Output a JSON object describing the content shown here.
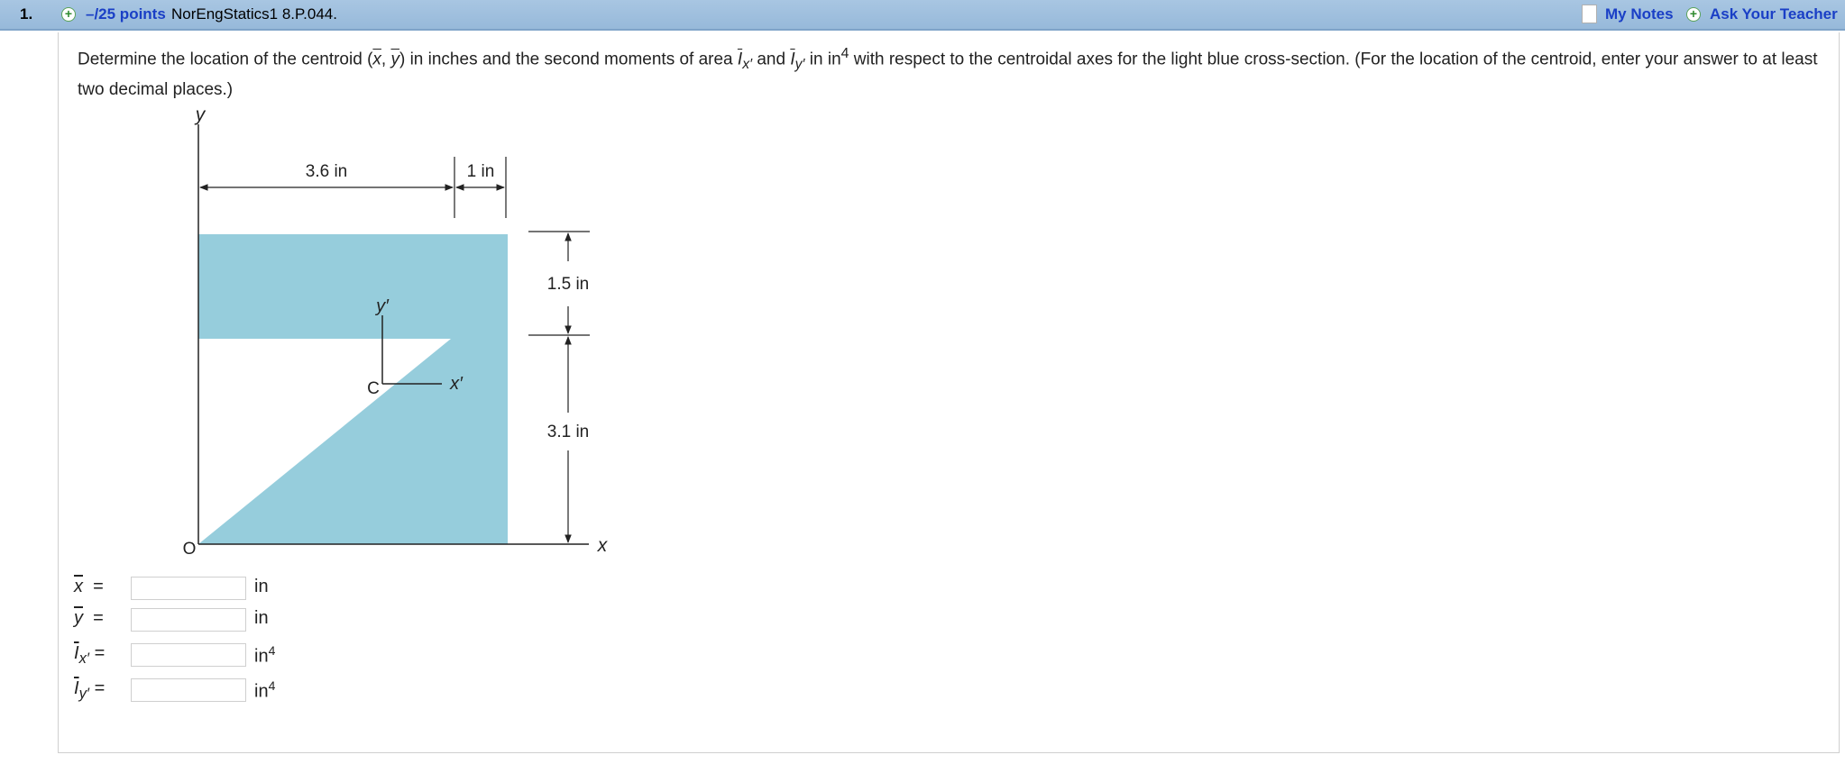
{
  "header": {
    "number": "1.",
    "points": "–/25 points",
    "question_id": "NorEngStatics1 8.P.044.",
    "my_notes": "My Notes",
    "ask_teacher": "Ask Your Teacher"
  },
  "question": {
    "p1": "Determine the location of the centroid (",
    "xbar": "x",
    "comma": ", ",
    "ybar": "y",
    "p2": ") in inches and the second moments of area ",
    "I1": "I",
    "I1_sub": "x′",
    "p3": " and ",
    "I2": "I",
    "I2_sub": "y′",
    "p4": " in in",
    "p4_sup": "4",
    "p5": " with respect to the centroidal axes for the light blue cross-section. (For the location of the centroid, enter your answer to at least two decimal places.)"
  },
  "figure": {
    "label_y": "y",
    "label_x": "x",
    "label_origin": "O",
    "label_c": "C",
    "label_xprime": "x′",
    "label_yprime": "y′",
    "dim_width": "3.6 in",
    "dim_flange": "1 in",
    "dim_top": "1.5 in",
    "dim_bottom": "3.1 in",
    "fill_color": "#96cddc"
  },
  "answers": [
    {
      "label": "x",
      "unit": "in",
      "value": ""
    },
    {
      "label": "y",
      "unit": "in",
      "value": ""
    },
    {
      "label": "I",
      "sub": "x′",
      "unit": "in",
      "unit_sup": "4",
      "value": ""
    },
    {
      "label": "I",
      "sub": "y′",
      "unit": "in",
      "unit_sup": "4",
      "value": ""
    }
  ]
}
